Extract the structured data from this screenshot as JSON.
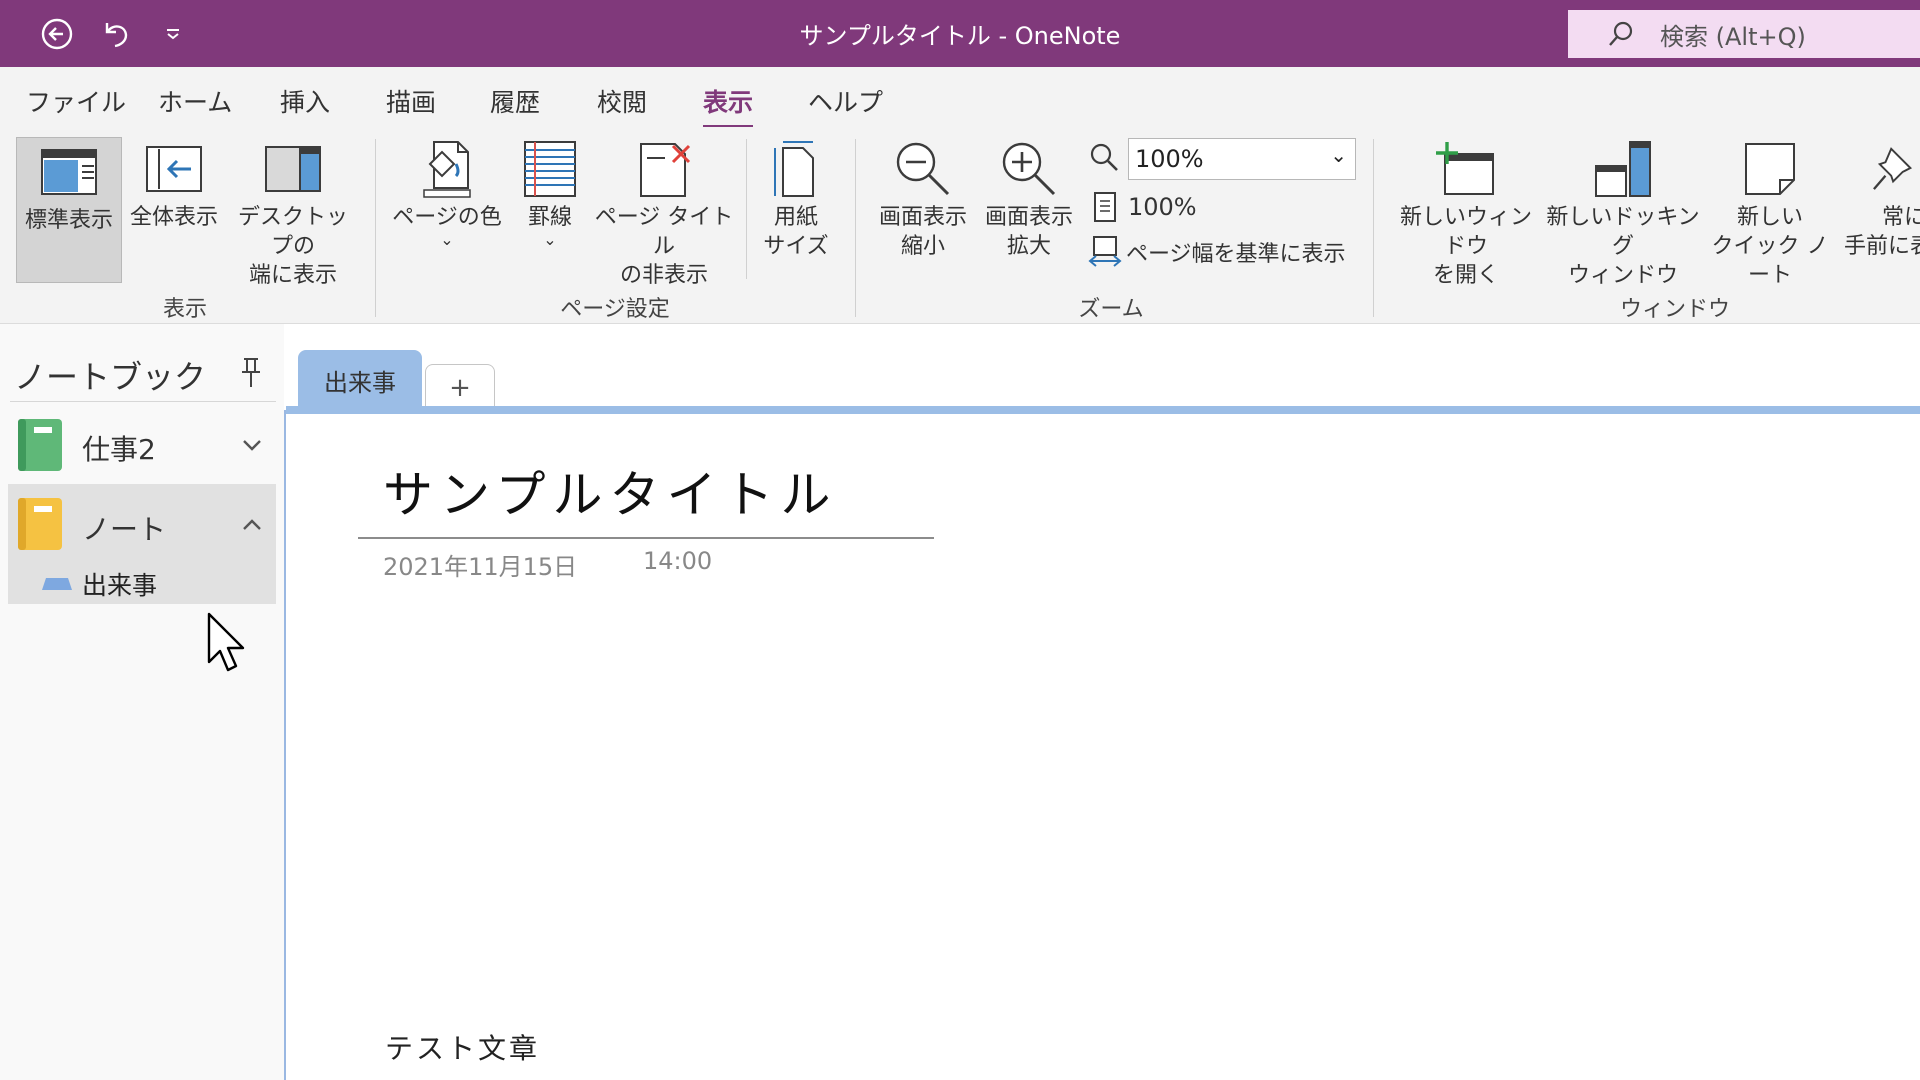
{
  "app": {
    "window_title": "サンプルタイトル  -  OneNote",
    "search_placeholder": "検索 (Alt+Q)"
  },
  "ribbon_tabs": [
    {
      "label": "ファイル"
    },
    {
      "label": "ホーム"
    },
    {
      "label": "挿入"
    },
    {
      "label": "描画"
    },
    {
      "label": "履歴"
    },
    {
      "label": "校閲"
    },
    {
      "label": "表示",
      "active": true
    },
    {
      "label": "ヘルプ"
    }
  ],
  "ribbon": {
    "view": {
      "group_label": "表示",
      "normal_view": "標準表示",
      "full_view": "全体表示",
      "dock_line1": "デスクトップの",
      "dock_line2": "端に表示"
    },
    "page_setup": {
      "group_label": "ページ設定",
      "page_color": "ページの色",
      "rule_lines": "罫線",
      "hide_title_line1": "ページ タイトル",
      "hide_title_line2": "の非表示",
      "paper_size_line1": "用紙",
      "paper_size_line2": "サイズ"
    },
    "zoom": {
      "group_label": "ズーム",
      "zoom_out_line1": "画面表示",
      "zoom_out_line2": "縮小",
      "zoom_in_line1": "画面表示",
      "zoom_in_line2": "拡大",
      "zoom_value": "100%",
      "hundred_percent": "100%",
      "page_width": "ページ幅を基準に表示"
    },
    "window": {
      "group_label": "ウィンドウ",
      "new_window_line1": "新しいウィンドウ",
      "new_window_line2": "を開く",
      "new_docked_line1": "新しいドッキング",
      "new_docked_line2": "ウィンドウ",
      "quick_note_line1": "新しい",
      "quick_note_line2": "クイック ノート",
      "on_top_line1": "常に",
      "on_top_line2": "手前に表"
    }
  },
  "navigation": {
    "title": "ノートブック",
    "notebooks": [
      {
        "label": "仕事2",
        "color": "#5fb878",
        "expanded": false
      },
      {
        "label": "ノート",
        "color": "#f5c242",
        "expanded": true
      }
    ],
    "sections": [
      {
        "label": "出来事",
        "color": "#7ea8e0"
      }
    ]
  },
  "section_tabs": {
    "active": "出来事",
    "add": "+"
  },
  "page": {
    "title": "サンプルタイトル",
    "date": "2021年11月15日",
    "time": "14:00",
    "body": "テスト文章"
  },
  "colors": {
    "accent": "#80397b",
    "section_blue": "#9bbde6"
  }
}
